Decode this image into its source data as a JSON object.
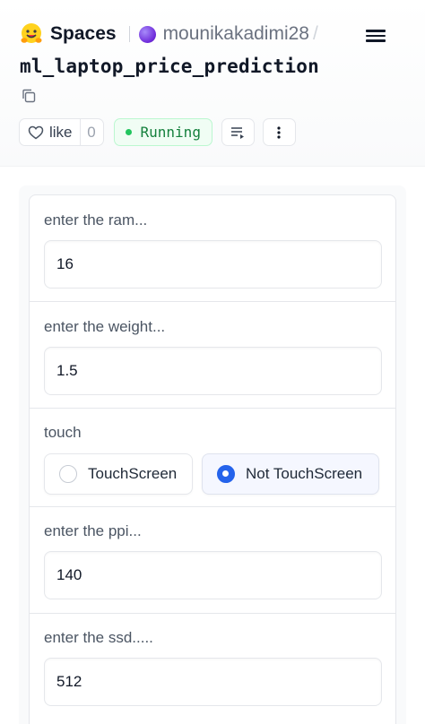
{
  "header": {
    "brand": "Spaces",
    "owner": "mounikakadimi28",
    "separator": "/",
    "space_title": "ml_laptop_price_prediction",
    "like_label": "like",
    "like_count": "0",
    "status": "Running",
    "status_color": "#22c55e"
  },
  "form": {
    "ram": {
      "label": "enter the ram...",
      "value": "16"
    },
    "weight": {
      "label": "enter the weight...",
      "value": "1.5"
    },
    "touch": {
      "label": "touch",
      "options": [
        "TouchScreen",
        "Not TouchScreen"
      ],
      "selected": "Not TouchScreen"
    },
    "ppi": {
      "label": "enter the ppi...",
      "value": "140"
    },
    "ssd": {
      "label": "enter the ssd.....",
      "value": "512"
    }
  },
  "icons": [
    "hugging-face-logo-icon",
    "menu-icon",
    "copy-icon",
    "heart-icon",
    "playlist-icon",
    "more-vertical-icon"
  ]
}
